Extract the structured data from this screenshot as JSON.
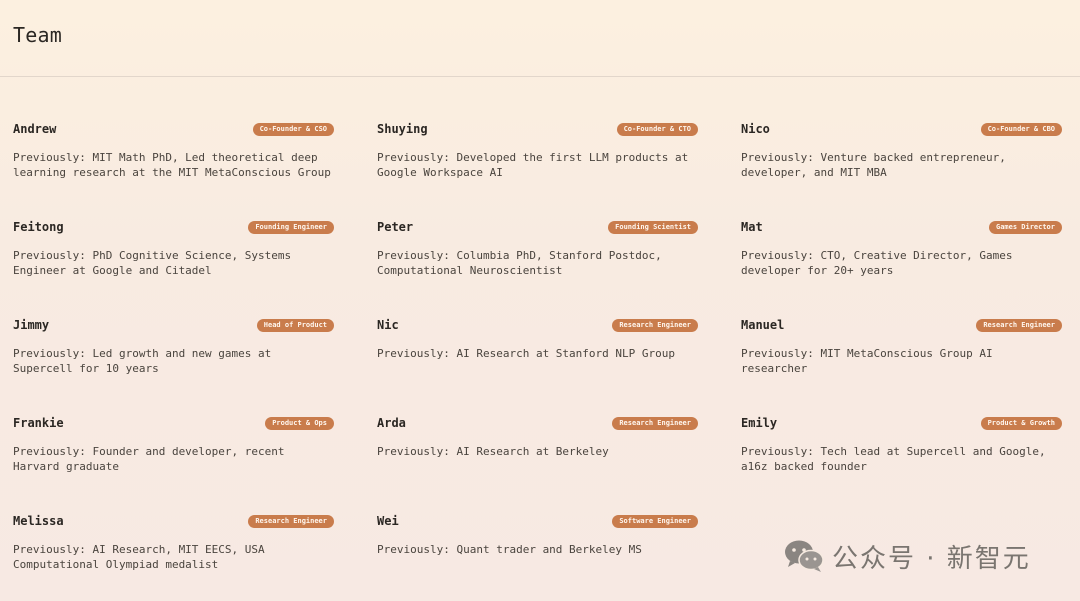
{
  "page": {
    "title": "Team"
  },
  "members": [
    {
      "name": "Andrew",
      "role": "Co-Founder & CSO",
      "bio": "Previously: MIT Math PhD, Led theoretical deep learning research at the MIT MetaConscious Group"
    },
    {
      "name": "Shuying",
      "role": "Co-Founder & CTO",
      "bio": "Previously: Developed the first LLM products at Google Workspace AI"
    },
    {
      "name": "Nico",
      "role": "Co-Founder & CBO",
      "bio": "Previously: Venture backed entrepreneur, developer, and MIT MBA"
    },
    {
      "name": "Feitong",
      "role": "Founding Engineer",
      "bio": "Previously: PhD Cognitive Science, Systems Engineer at Google and Citadel"
    },
    {
      "name": "Peter",
      "role": "Founding Scientist",
      "bio": "Previously: Columbia PhD, Stanford Postdoc, Computational Neuroscientist"
    },
    {
      "name": "Mat",
      "role": "Games Director",
      "bio": "Previously: CTO, Creative Director, Games developer for 20+ years"
    },
    {
      "name": "Jimmy",
      "role": "Head of Product",
      "bio": "Previously: Led growth and new games at Supercell for 10 years"
    },
    {
      "name": "Nic",
      "role": "Research Engineer",
      "bio": "Previously: AI Research at Stanford NLP Group"
    },
    {
      "name": "Manuel",
      "role": "Research Engineer",
      "bio": "Previously: MIT MetaConscious Group AI researcher"
    },
    {
      "name": "Frankie",
      "role": "Product & Ops",
      "bio": "Previously: Founder and developer, recent Harvard graduate"
    },
    {
      "name": "Arda",
      "role": "Research Engineer",
      "bio": "Previously: AI Research at Berkeley"
    },
    {
      "name": "Emily",
      "role": "Product & Growth",
      "bio": "Previously: Tech lead at Supercell and Google, a16z backed founder"
    },
    {
      "name": "Melissa",
      "role": "Research Engineer",
      "bio": "Previously: AI Research, MIT EECS, USA Computational Olympiad medalist"
    },
    {
      "name": "Wei",
      "role": "Software Engineer",
      "bio": "Previously: Quant trader and Berkeley MS"
    }
  ],
  "watermark": {
    "icon": "wechat-icon",
    "text": "公众号 · 新智元"
  }
}
